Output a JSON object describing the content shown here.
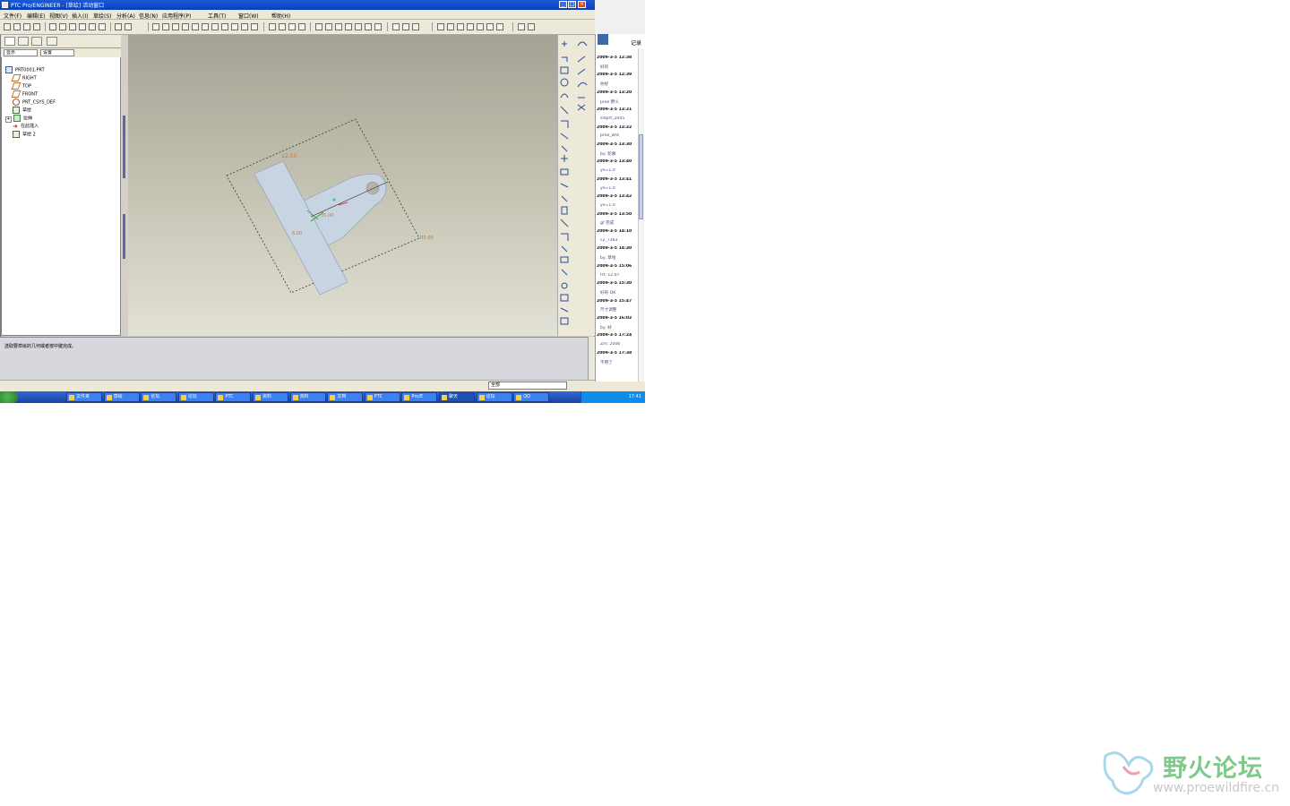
{
  "window": {
    "title": "PTC Pro/ENGINEER - [草绘] 活动窗口",
    "min": "_",
    "max": "□",
    "close": "×"
  },
  "menu": [
    "文件(F)",
    "编辑(E)",
    "视图(V)",
    "插入(I)",
    "草绘(S)",
    "分析(A)",
    "信息(N)",
    "应用程序(P)",
    "工具(T)",
    "窗口(W)",
    "帮助(H)"
  ],
  "tree": {
    "show_dropdown": "显示",
    "settings_dropdown": "设置",
    "items": [
      {
        "label": "PRT0001.PRT",
        "icon": "part-icon"
      },
      {
        "label": "RIGHT",
        "icon": "datum-plane-icon"
      },
      {
        "label": "TOP",
        "icon": "datum-plane-icon"
      },
      {
        "label": "FRONT",
        "icon": "datum-plane-icon"
      },
      {
        "label": "PRT_CSYS_DEF",
        "icon": "csys-icon"
      },
      {
        "label": "草绘",
        "icon": "sketch-icon"
      },
      {
        "label": "拉伸",
        "icon": "extrude-icon"
      },
      {
        "label": "在此插入",
        "icon": "insert-here-icon"
      },
      {
        "label": "草绘 2",
        "icon": "sketch-icon"
      }
    ]
  },
  "sketch": {
    "dim_labels": [
      "12.50",
      "35.00",
      "6.00",
      "R5.00"
    ]
  },
  "message": {
    "text": "选取要草绘的几何或者按中键完成。"
  },
  "status": {
    "filter": "全部"
  },
  "side_panel": {
    "tab": "记录",
    "rows": [
      {
        "t": "2009-3-5 12:38",
        "s": "b"
      },
      {
        "t": "好的",
        "s": "g"
      },
      {
        "t": "2009-3-5 12:39",
        "s": "b"
      },
      {
        "t": "你好",
        "s": "g"
      },
      {
        "t": "2009-3-5 13:20",
        "s": "b"
      },
      {
        "t": "proe 野火",
        "s": "g"
      },
      {
        "t": "2009-3-5 13:21",
        "s": "b"
      },
      {
        "t": "sldprt_2005",
        "s": "g"
      },
      {
        "t": "2009-3-5 13:22",
        "s": "b"
      },
      {
        "t": "proe_wf4",
        "s": "g"
      },
      {
        "t": "2009-3-5 13:30",
        "s": "b"
      },
      {
        "t": "by: 轮廓",
        "s": "g"
      },
      {
        "t": "2009-3-5 13:40",
        "s": "b"
      },
      {
        "t": "ye=1.0",
        "s": "g"
      },
      {
        "t": "2009-3-5 13:41",
        "s": "b"
      },
      {
        "t": "ye=1.0",
        "s": "g"
      },
      {
        "t": "2009-3-5 13:42",
        "s": "b"
      },
      {
        "t": "ye=1.0",
        "s": "g"
      },
      {
        "t": "2009-3-5 13:50",
        "s": "b"
      },
      {
        "t": "gf 完成",
        "s": "g"
      },
      {
        "t": "2009-3-5 14:10",
        "s": "b"
      },
      {
        "t": "c2_7363",
        "s": "g"
      },
      {
        "t": "2009-3-5 14:30",
        "s": "b"
      },
      {
        "t": "by: 草绘",
        "s": "g"
      },
      {
        "t": "2009-3-5 15:06",
        "s": "b"
      },
      {
        "t": "frt: 12.07",
        "s": "g"
      },
      {
        "t": "2009-3-5 15:30",
        "s": "b"
      },
      {
        "t": "好的 OK",
        "s": "g"
      },
      {
        "t": "2009-3-5 15:47",
        "s": "b"
      },
      {
        "t": "尺寸调整",
        "s": "g"
      },
      {
        "t": "2009-3-5 16:02",
        "s": "b"
      },
      {
        "t": "by: 好",
        "s": "g"
      },
      {
        "t": "2009-3-5 17:24",
        "s": "b"
      },
      {
        "t": "Zm: 2006",
        "s": "g"
      },
      {
        "t": "2009-3-5 17:38",
        "s": "b"
      },
      {
        "t": "不用了",
        "s": "g"
      }
    ]
  },
  "taskbar": {
    "tasks": [
      "文件夹",
      "草绘",
      "论坛",
      "论坛",
      "PTC",
      "资料",
      "资料",
      "文档",
      "PTC",
      "Pro/E",
      "聊天",
      "论坛",
      "QQ"
    ],
    "clock": "17:41"
  },
  "watermark": {
    "name": "野火论坛",
    "url": "www.proewildfire.cn"
  },
  "colors": {
    "title_blue": "#1c5ad8",
    "part_fill": "#c8d4e2",
    "dim_orange": "#c87830",
    "watermark_green": "#7fc98a"
  }
}
